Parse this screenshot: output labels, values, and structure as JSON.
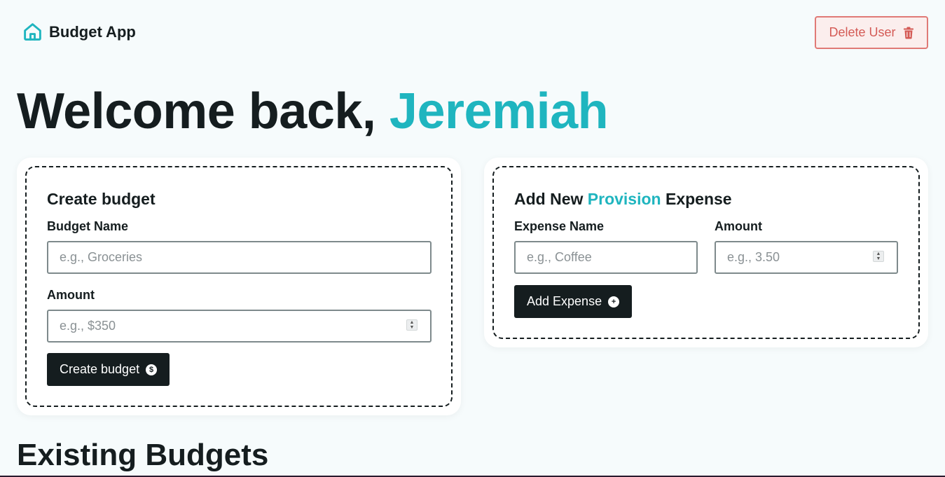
{
  "app": {
    "brand": "Budget App",
    "delete_user_label": "Delete User"
  },
  "welcome": {
    "prefix": "Welcome back, ",
    "username": "Jeremiah"
  },
  "create_budget": {
    "title": "Create budget",
    "name_label": "Budget Name",
    "name_placeholder": "e.g., Groceries",
    "amount_label": "Amount",
    "amount_placeholder": "e.g., $350",
    "submit_label": "Create budget"
  },
  "add_expense": {
    "title_prefix": "Add New ",
    "title_budget": "Provision",
    "title_suffix": " Expense",
    "name_label": "Expense Name",
    "name_placeholder": "e.g., Coffee",
    "amount_label": "Amount",
    "amount_placeholder": "e.g., 3.50",
    "submit_label": "Add Expense"
  },
  "existing": {
    "title": "Existing Budgets"
  },
  "colors": {
    "accent": "#1fb5bf",
    "dark": "#151d1f",
    "danger": "#d45a55",
    "background": "#f6fbfc"
  },
  "icons": {
    "logo": "home-icon",
    "delete": "trash-icon",
    "create_budget": "dollar-circle-icon",
    "add_expense": "plus-circle-icon"
  }
}
